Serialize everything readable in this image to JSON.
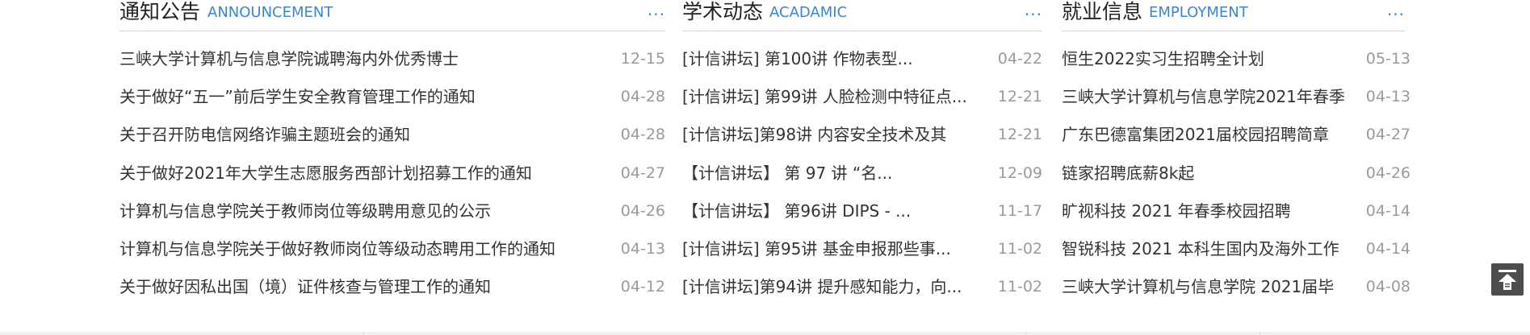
{
  "columns": [
    {
      "title": "通知公告",
      "subtitle": "ANNOUNCEMENT",
      "more": "...",
      "items": [
        {
          "title": "三峡大学计算机与信息学院诚聘海内外优秀博士",
          "date": "12-15"
        },
        {
          "title": "关于做好“五一”前后学生安全教育管理工作的通知",
          "date": "04-28"
        },
        {
          "title": "关于召开防电信网络诈骗主题班会的通知",
          "date": "04-28"
        },
        {
          "title": "关于做好2021年大学生志愿服务西部计划招募工作的通知",
          "date": "04-27"
        },
        {
          "title": "计算机与信息学院关于教师岗位等级聘用意见的公示",
          "date": "04-26"
        },
        {
          "title": "计算机与信息学院关于做好教师岗位等级动态聘用工作的通知",
          "date": "04-13"
        },
        {
          "title": "关于做好因私出国（境）证件核查与管理工作的通知",
          "date": "04-12"
        }
      ]
    },
    {
      "title": "学术动态",
      "subtitle": "ACADAMIC",
      "more": "...",
      "items": [
        {
          "title": "[计信讲坛] 第100讲 作物表型...",
          "date": "04-22"
        },
        {
          "title": "[计信讲坛] 第99讲 人脸检测中特征点...",
          "date": "12-21"
        },
        {
          "title": "[计信讲坛]第98讲 内容安全技术及其",
          "date": "12-21"
        },
        {
          "title": "【计信讲坛】 第 97 讲 “名...",
          "date": "12-09"
        },
        {
          "title": "【计信讲坛】 第96讲 DIPS - ...",
          "date": "11-17"
        },
        {
          "title": "[计信讲坛] 第95讲 基金申报那些事...",
          "date": "11-02"
        },
        {
          "title": "[计信讲坛]第94讲 提升感知能力，向...",
          "date": "11-02"
        }
      ]
    },
    {
      "title": "就业信息",
      "subtitle": "EMPLOYMENT",
      "more": "...",
      "items": [
        {
          "title": "恒生2022实习生招聘全计划",
          "date": "05-13"
        },
        {
          "title": "三峡大学计算机与信息学院2021年春季",
          "date": "04-13"
        },
        {
          "title": "广东巴德富集团2021届校园招聘简章",
          "date": "04-27"
        },
        {
          "title": "链家招聘底薪8k起",
          "date": "04-26"
        },
        {
          "title": "旷视科技 2021 年春季校园招聘",
          "date": "04-14"
        },
        {
          "title": "智锐科技 2021 本科生国内及海外工作",
          "date": "04-14"
        },
        {
          "title": "三峡大学计算机与信息学院 2021届毕",
          "date": "04-08"
        }
      ]
    }
  ],
  "back_to_top": {
    "icon": "back-to-top-icon"
  }
}
